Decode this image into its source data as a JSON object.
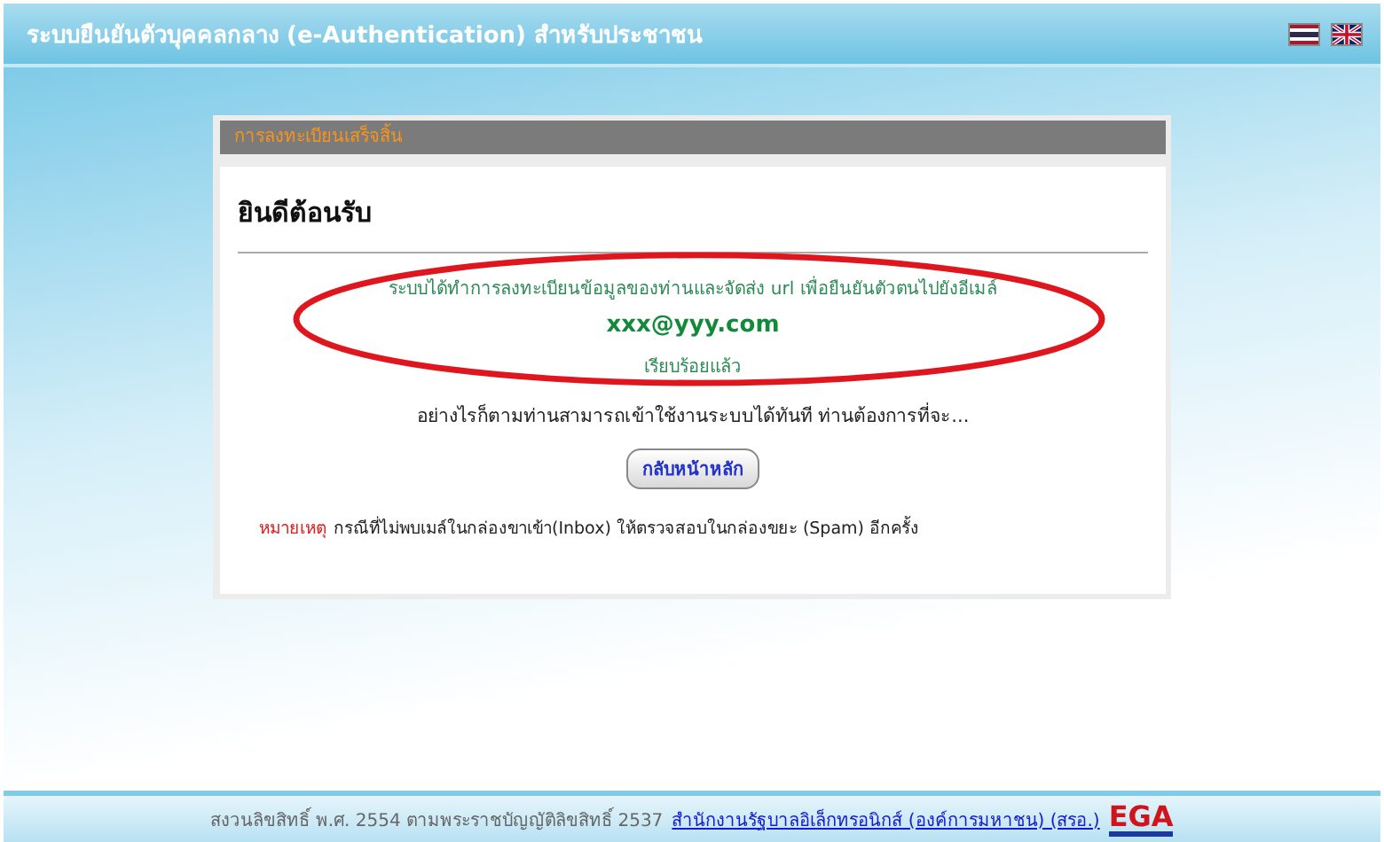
{
  "header": {
    "title": "ระบบยืนยันตัวบุคคลกลาง (e-Authentication) สำหรับประชาชน",
    "languages": [
      {
        "kind": "thai",
        "selected": false
      },
      {
        "kind": "english",
        "selected": false
      }
    ]
  },
  "panel": {
    "title": "การลงทะเบียนเสร็จสิ้น",
    "heading": "ยินดีต้อนรับ",
    "message": "ระบบได้ทำการลงทะเบียนข้อมูลของท่านและจัดส่ง url เพื่อยืนยันตัวตนไปยังอีเมล์",
    "email": "xxx@yyy.com",
    "done": "เรียบร้อยแล้ว",
    "prompt": "อย่างไรก็ตามท่านสามารถเข้าใช้งานระบบได้ทันที ท่านต้องการที่จะ...",
    "button": "กลับหน้าหลัก",
    "note_label": "หมายเหตุ",
    "note": "กรณีที่ไม่พบเมล์ในกล่องขาเข้า(Inbox) ให้ตรวจสอบในกล่องขยะ (Spam) อีกครั้ง",
    "highlighted": true
  },
  "footer": {
    "copyright": "สงวนลิขสิทธิ์ พ.ศ. 2554 ตามพระราชบัญญัติลิขสิทธิ์ 2537",
    "link": "สำนักงานรัฐบาลอิเล็กทรอนิกส์ (องค์การมหาชน) (สรอ.)",
    "logo": "EGA"
  }
}
